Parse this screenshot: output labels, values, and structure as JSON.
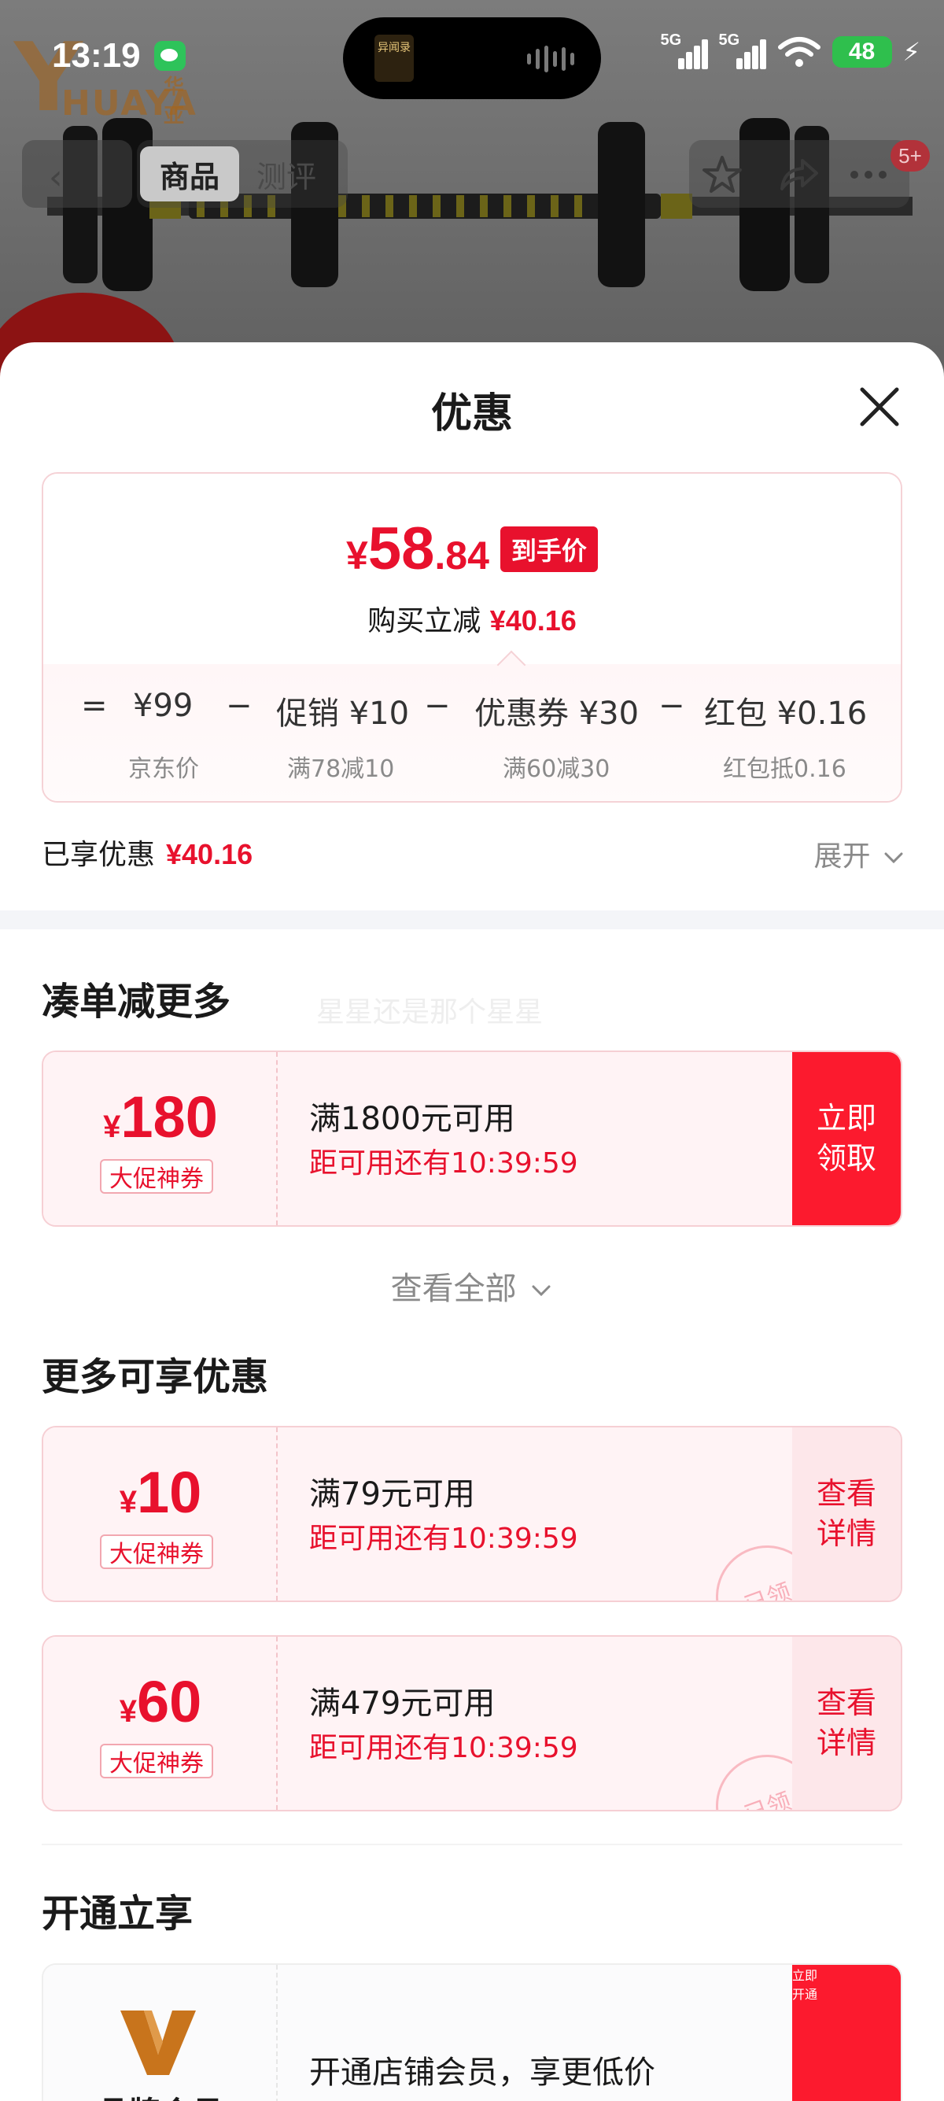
{
  "status_bar": {
    "time": "13:19",
    "signal_1": "5G",
    "signal_2": "5G",
    "battery": "48",
    "island_cover_text": "异闻录"
  },
  "background": {
    "brand_cn": "华亚",
    "brand_en": "HUAYA",
    "tabs": [
      "商品",
      "测评"
    ],
    "notification_badge": "5+"
  },
  "sheet": {
    "title": "优惠",
    "final_price": {
      "currency": "¥",
      "integer": "58",
      "decimal": ".84",
      "tag": "到手价"
    },
    "save_label": "购买立减",
    "save_amount": "¥40.16",
    "formula": [
      {
        "op": "=",
        "value": "¥99",
        "desc": "京东价"
      },
      {
        "op": "−",
        "value": "促销 ¥10",
        "desc": "满78减10"
      },
      {
        "op": "−",
        "value": "优惠券 ¥30",
        "desc": "满60减30"
      },
      {
        "op": "−",
        "value": "红包 ¥0.16",
        "desc": "红包抵0.16"
      }
    ],
    "enjoyed_label": "已享优惠",
    "enjoyed_amount": "¥40.16",
    "expand_label": "展开"
  },
  "combine_section": {
    "title": "凑单减更多",
    "watermark": "星星还是那个星星",
    "coupons": [
      {
        "currency": "¥",
        "amount": "180",
        "label": "大促神券",
        "condition": "满1800元可用",
        "timer": "距可用还有10:39:59",
        "cta": [
          "立即",
          "领取"
        ]
      }
    ],
    "view_all": "查看全部"
  },
  "more_section": {
    "title": "更多可享优惠",
    "coupons": [
      {
        "currency": "¥",
        "amount": "10",
        "label": "大促神券",
        "condition": "满79元可用",
        "timer": "距可用还有10:39:59",
        "cta": [
          "查看",
          "详情"
        ],
        "stamp": "已领"
      },
      {
        "currency": "¥",
        "amount": "60",
        "label": "大促神券",
        "condition": "满479元可用",
        "timer": "距可用还有10:39:59",
        "cta": [
          "查看",
          "详情"
        ],
        "stamp": "已领"
      }
    ]
  },
  "open_section": {
    "title": "开通立享",
    "member_title": "品牌会员",
    "description": "开通店铺会员，享更低价",
    "cta": [
      "立即",
      "开通"
    ]
  },
  "colors": {
    "accent_red": "#e8112d",
    "cta_red": "#fc1a2e",
    "coupon_bg": "#fff3f5",
    "member_logo": "#c8741c"
  }
}
